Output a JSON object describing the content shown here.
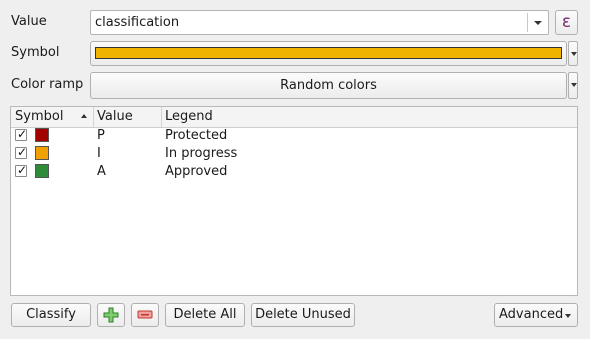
{
  "form": {
    "value_label": "Value",
    "value_field": "classification",
    "symbol_label": "Symbol",
    "symbol_color": "#f0b400",
    "color_ramp_label": "Color ramp",
    "color_ramp_value": "Random colors",
    "expression_icon": "ε"
  },
  "table": {
    "headers": {
      "symbol": "Symbol",
      "value": "Value",
      "legend": "Legend"
    },
    "rows": [
      {
        "checked": true,
        "color": "#a30000",
        "value": "P",
        "legend": "Protected"
      },
      {
        "checked": true,
        "color": "#f0a000",
        "value": "I",
        "legend": "In progress"
      },
      {
        "checked": true,
        "color": "#2e8b37",
        "value": "A",
        "legend": "Approved"
      }
    ]
  },
  "buttons": {
    "classify": "Classify",
    "add_icon": "plus-icon",
    "remove_icon": "minus-icon",
    "delete_all": "Delete All",
    "delete_unused": "Delete Unused",
    "advanced": "Advanced"
  }
}
